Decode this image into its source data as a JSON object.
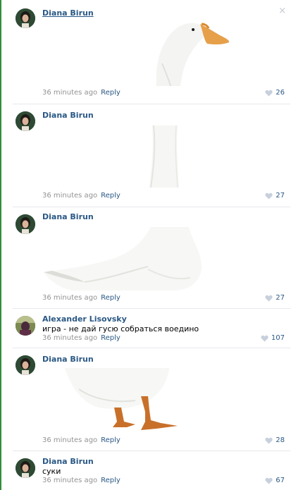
{
  "comments": [
    {
      "author": "Diana Birun",
      "time": "36 minutes ago",
      "reply": "Reply",
      "likes": "26",
      "close": "×"
    },
    {
      "author": "Diana Birun",
      "time": "36 minutes ago",
      "reply": "Reply",
      "likes": "27"
    },
    {
      "author": "Diana Birun",
      "time": "36 minutes ago",
      "reply": "Reply",
      "likes": "27"
    },
    {
      "author": "Alexander Lisovsky",
      "text": "игра - не дай гусю собраться воедино",
      "time": "36 minutes ago",
      "reply": "Reply",
      "likes": "107"
    },
    {
      "author": "Diana Birun",
      "time": "36 minutes ago",
      "reply": "Reply",
      "likes": "28"
    },
    {
      "author": "Diana Birun",
      "text": "суки",
      "time": "36 minutes ago",
      "reply": "Reply",
      "likes": "67"
    }
  ],
  "colors": {
    "link": "#2a5885",
    "meta": "#939393",
    "heart": "#c7d0dc",
    "gutter": "#2f8f3b"
  },
  "icons": {
    "like": "heart-icon",
    "close": "close-icon"
  }
}
